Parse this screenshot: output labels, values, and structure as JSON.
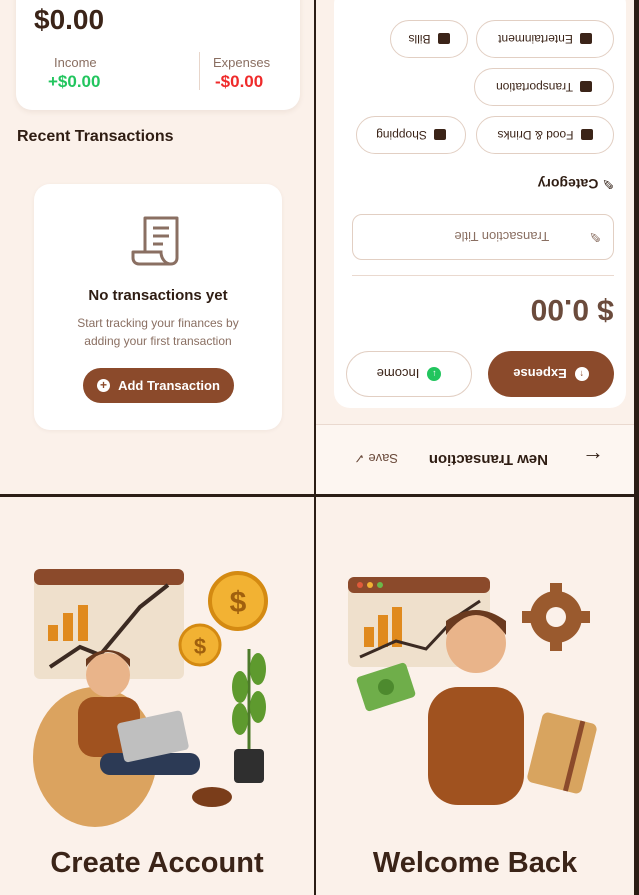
{
  "home": {
    "balance": "$0.00",
    "income_label": "Income",
    "income_value": "+$0.00",
    "expenses_label": "Expenses",
    "expenses_value": "-$0.00",
    "recent_title": "Recent Transactions",
    "empty_title": "No transactions yet",
    "empty_subtitle": "Start tracking your finances by adding your first transaction",
    "add_button": "Add Transaction"
  },
  "new_transaction": {
    "title": "New Transaction",
    "save_label": "Save",
    "type_expense": "Expense",
    "type_income": "Income",
    "amount": "$ 0.00",
    "title_placeholder": "Transaction Title",
    "category_label": "Category",
    "categories": [
      "Food & Drinks",
      "Shopping",
      "Transportation",
      "Entertainment",
      "Bills"
    ]
  },
  "onboarding": {
    "create_account": "Create Account",
    "welcome_back": "Welcome Back"
  },
  "colors": {
    "background": "#fbf1ea",
    "primary": "#8b4a2b",
    "income_green": "#22c55e",
    "expense_red": "#ef2b2b"
  }
}
